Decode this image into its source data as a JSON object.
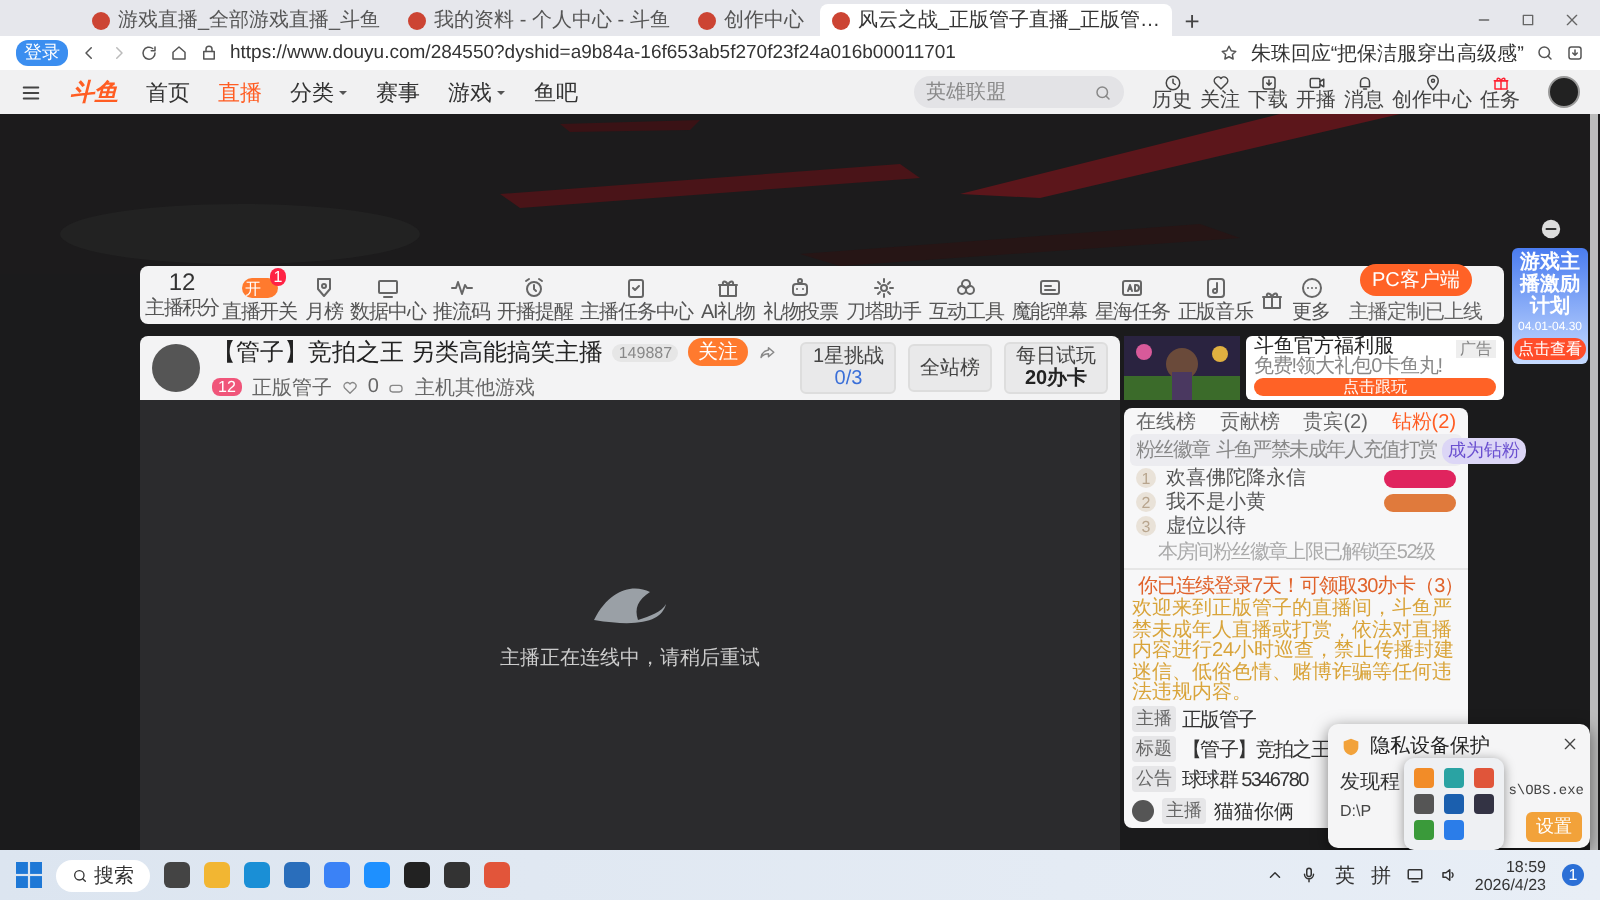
{
  "browser": {
    "tabs": [
      {
        "title": "游戏直播_全部游戏直播_斗鱼",
        "selected": false
      },
      {
        "title": "我的资料 - 个人中心 - 斗鱼",
        "selected": false
      },
      {
        "title": "创作中心",
        "selected": false
      },
      {
        "title": "风云之战_正版管子直播_正版管…",
        "selected": true
      }
    ],
    "new_tab": "+",
    "login_badge": "登录",
    "url": "https://www.douyu.com/284550?dyshid=a9b84a-16f653ab5f270f23f24a016b00011701",
    "hot_search": "朱珠回应“把保洁服穿出高级感”"
  },
  "site_nav": {
    "logo": "斗鱼",
    "items": [
      {
        "label": "首页",
        "selected": false,
        "dropdown": false
      },
      {
        "label": "直播",
        "selected": true,
        "dropdown": false
      },
      {
        "label": "分类",
        "selected": false,
        "dropdown": true
      },
      {
        "label": "赛事",
        "selected": false,
        "dropdown": false
      },
      {
        "label": "游戏",
        "selected": false,
        "dropdown": true
      },
      {
        "label": "鱼吧",
        "selected": false,
        "dropdown": false
      }
    ],
    "search": {
      "placeholder": "英雄联盟"
    },
    "actions": [
      "历史",
      "关注",
      "下载",
      "开播",
      "消息",
      "创作中心",
      "任务"
    ]
  },
  "toolbar": {
    "score": {
      "value": "12",
      "label": "主播积分"
    },
    "items": [
      {
        "kind": "toggle",
        "label": "直播开关",
        "toggle_text": "开",
        "on": true,
        "badge": "1"
      },
      {
        "kind": "icon",
        "label": "月榜"
      },
      {
        "kind": "icon",
        "label": "数据中心"
      },
      {
        "kind": "icon",
        "label": "推流码"
      },
      {
        "kind": "icon",
        "label": "开播提醒"
      },
      {
        "kind": "icon",
        "label": "主播任务中心"
      },
      {
        "kind": "icon",
        "label": "AI礼物"
      },
      {
        "kind": "icon",
        "label": "礼物投票"
      },
      {
        "kind": "icon",
        "label": "刀塔助手"
      },
      {
        "kind": "icon",
        "label": "互动工具"
      },
      {
        "kind": "icon",
        "label": "魔能弹幕"
      },
      {
        "kind": "icon",
        "label": "星海任务"
      },
      {
        "kind": "icon",
        "label": "正版音乐"
      },
      {
        "kind": "icon"
      },
      {
        "kind": "icon",
        "label": "更多"
      }
    ],
    "client_button": "PC客户端",
    "client_note": "主播定制已上线"
  },
  "streamer": {
    "title": "【管子】竞拍之王 另类高能搞笑主播",
    "followers": "149887",
    "follow_button": "关注",
    "level": "12",
    "name": "正版管子",
    "likes": "0",
    "category": "主机其他游戏",
    "challenge": {
      "label": "1星挑战",
      "progress": "0/3"
    },
    "rank_button": "全站榜",
    "daily": {
      "label": "每日试玩",
      "reward": "20办卡"
    }
  },
  "ad": {
    "title": "斗鱼官方福利服",
    "subtitle": "免费!领大礼包0卡鱼丸!",
    "button": "点击跟玩",
    "tag": "广告"
  },
  "video": {
    "status": "主播正在连线中，请稍后重试"
  },
  "chat": {
    "tabs": [
      {
        "label": "在线榜",
        "selected": false
      },
      {
        "label": "贡献榜",
        "selected": false
      },
      {
        "label": "贵宾(2)",
        "selected": false
      },
      {
        "label": "钻粉(2)",
        "selected": true
      }
    ],
    "fan_badge_label": "粉丝徽章",
    "notice": "斗鱼严禁未成年人充值打赏",
    "become_button": "成为钻粉",
    "ranking": [
      {
        "rank": "1",
        "name": "欢喜佛陀降永信",
        "color": "#e0245e"
      },
      {
        "rank": "2",
        "name": "我不是小黄",
        "color": "#e07a3c"
      },
      {
        "rank": "3",
        "name": "虚位以待"
      }
    ],
    "limit_note": "本房间粉丝徽章上限已解锁至52级",
    "login_notice": "你已连续登录7天！可领取30办卡（3）",
    "welcome": "欢迎来到正版管子的直播间，斗鱼严禁未成年人直播或打赏，依法对直播内容进行24小时巡查，禁止传播封建迷信、低俗色情、赌博诈骗等任何违法违规内容。",
    "info": [
      {
        "label": "主播",
        "value": "正版管子"
      },
      {
        "label": "标题",
        "value": "【管子】竞拍之王"
      },
      {
        "label": "公告",
        "value": "球球群 5346780"
      }
    ],
    "last_message": {
      "label": "主播",
      "name": "猫猫你俩"
    }
  },
  "popup": {
    "title": "隐私设备保护",
    "line": "发现程",
    "path_start": "D:\\P",
    "path_end": "s\\OBS.exe",
    "button": "设置"
  },
  "side_banner": {
    "title": "游戏主播激励计划",
    "dates": "04.01-04.30",
    "button": "点击查看"
  },
  "taskbar": {
    "search": "搜索",
    "ime": [
      "英",
      "拼"
    ],
    "time": "18:59",
    "date": "2026/4/23",
    "notifications": "1"
  }
}
